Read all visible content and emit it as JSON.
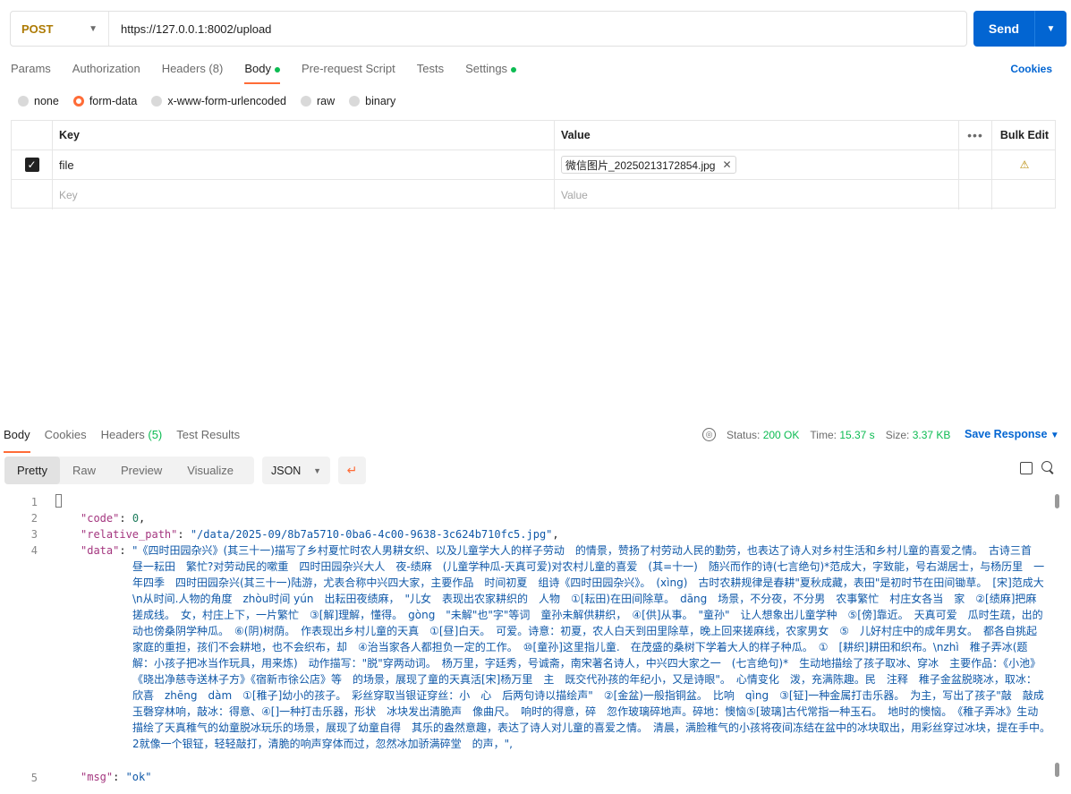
{
  "request": {
    "method": "POST",
    "url": "https://127.0.0.1:8002/upload",
    "send_label": "Send"
  },
  "req_tabs": [
    {
      "label": "Params"
    },
    {
      "label": "Authorization"
    },
    {
      "label": "Headers (8)"
    },
    {
      "label": "Body"
    },
    {
      "label": "Pre-request Script"
    },
    {
      "label": "Tests"
    },
    {
      "label": "Settings"
    }
  ],
  "cookies_label": "Cookies",
  "body_types": [
    "none",
    "form-data",
    "x-www-form-urlencoded",
    "raw",
    "binary"
  ],
  "table": {
    "headers": {
      "key": "Key",
      "value": "Value",
      "bulk": "Bulk Edit"
    },
    "row": {
      "key": "file",
      "value": "微信图片_20250213172854.jpg"
    },
    "placeholder": {
      "key": "Key",
      "value": "Value"
    }
  },
  "response": {
    "tabs": [
      "Body",
      "Cookies",
      "Headers",
      "Test Results"
    ],
    "headers_count": "(5)",
    "status_label": "Status:",
    "status_value": "200 OK",
    "time_label": "Time:",
    "time_value": "15.37 s",
    "size_label": "Size:",
    "size_value": "3.37 KB",
    "save_label": "Save Response",
    "views": [
      "Pretty",
      "Raw",
      "Preview",
      "Visualize"
    ],
    "format": "JSON"
  },
  "json": {
    "code_key": "\"code\"",
    "code_val": "0",
    "path_key": "\"relative_path\"",
    "path_val": "\"/data/2025-09/8b7a5710-0ba6-4c00-9638-3c624b710fc5.jpg\"",
    "data_key": "\"data\"",
    "data_val": "\"《四时田园杂兴》(其三十一)描写了乡村夏忙时农人男耕女织、以及儿童学大人的样子劳动　的情景，赞扬了村劳动人民的勤劳，也表达了诗人对乡村生活和乡村儿童的喜爱之情。　古诗三首　昼一耘田　繁忙?对劳动民的嗽重　四时田园杂兴大人　夜-绩麻　(儿童学种瓜-天真可爱)对农村儿童的喜爱　(其=十一)　随兴而作的诗(七言绝句)*范成大，字致能，号右湖居士，与杨历里　一年四季　四时田园杂兴(其三十一)陆游，尤表合称中兴四大家，主要作品　时间初夏　组诗《四时田园杂兴》。　(xìng)　古时农耕规律是春耕\"夏秋成藏，表田\"是初时节在田间锄草。　[宋]范成大\\n从时间.人物的角度　zhòu时间 yún　出耘田夜绩麻，　\"儿女　表现出农家耕织的　人物　①[耘田)在田间除草。　dāng　场景，不分夜，不分男　农事繁忙　村庄女各当　家　②[绩麻]把麻搓成线。　女，村庄上下，一片繁忙　③[解]理解，懂得。　gòng　\"未解\"也\"字\"等词　童孙未解供耕织，　④[供]从事。　\"童孙\"　让人想象出儿童学种　⑤[傍]靠近。　天真可爱　瓜时生疏，出的动也傍桑阴学种瓜。　⑥(阴)树荫。　作表现出乡村儿童的天真　①[昼]白天。　可爱。诗意：初夏，农人白天到田里除草，晚上回来搓麻线，农家男女　⑤　儿好村庄中的成年男女。　都各自挑起家庭的重担，孩们不会耕地，也不会织布，却　④治当家各人都担负一定的工作。　⑩[童孙]这里指儿童.　在茂盛的桑树下学着大人的样子种瓜。　①　[耕织]耕田和织布。\\nzhì　稚子弄冰(题解：小孩子把冰当作玩具，用来炼)　动作描写：\"脱\"穿两动词。　杨万里，字廷秀，号诚斋，南宋著名诗人，中兴四大家之一　(七言绝句)*　生动地描绘了孩子取冰、穿冰　主要作品：《小池》《晓出净慈寺送林子方》《宿新市徐公店》等　的场景，展现了童的天真活[宋]杨万里　主　既交代孙孩的年纪小，又是诗眼\"。　心情变化　泼，充满陈趣。民　注释　稚子金盆脱晓冰，取冰：欣喜　zhēng　dàm　①[稚子]幼小的孩子。　彩丝穿取当银证穿丝：小　心　后两句诗以描绘声\"　②[金盆)一般指铜盆。　比响　qìng　③[钲]一种金属打击乐器。　为主，写出了孩子\"敲　敲成玉磬穿林响，敲冰：得意、④[]一种打击乐器，形状　冰块发出清脆声　像曲尺。　响时的得意，碎　忽作玻璃碎地声。碎地：懊恼⑤[玻璃]古代常指一种玉石。　地时的懊恼。　《稚子弄冰》生动描绘了天真稚气的幼童脱冰玩乐的场景，展现了幼童自得　其乐的盎然意趣，表达了诗人对儿童的喜爱之情。　清晨，满脸稚气的小孩将夜间冻结在盆中的冰块取出，用彩丝穿过冰块，提在手中。　2就像一个银钲，轻轻敲打，清脆的响声穿体而过，忽然冰加骄满碎堂　的声，\",",
    "msg_key": "\"msg\"",
    "msg_val": "\"ok\""
  },
  "line_numbers": [
    "1",
    "2",
    "3",
    "4",
    "5"
  ]
}
